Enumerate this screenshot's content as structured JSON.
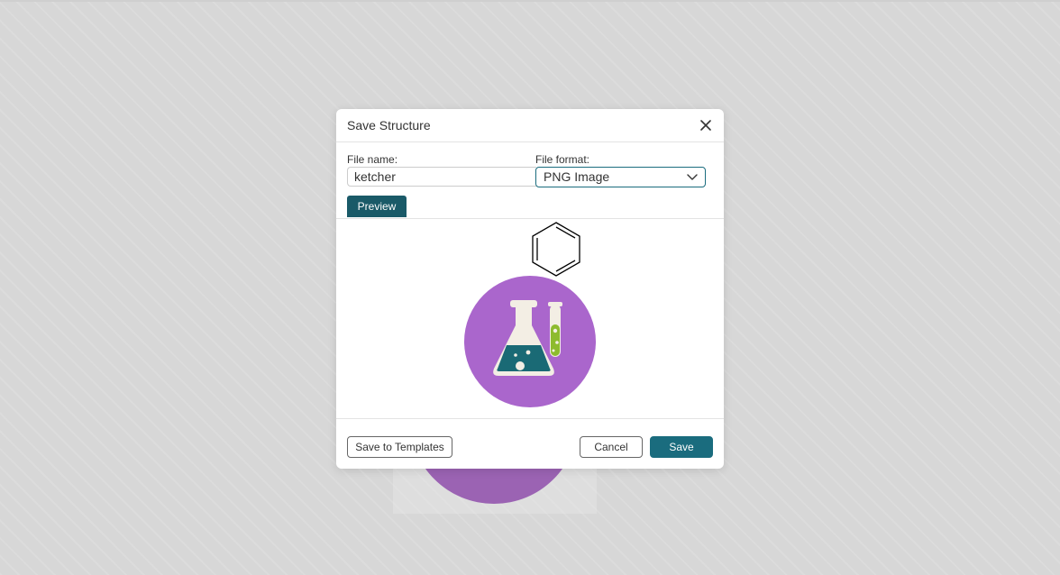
{
  "dialog": {
    "title": "Save Structure",
    "close_icon": "close-icon"
  },
  "form": {
    "file_name_label": "File name:",
    "file_name_value": "ketcher",
    "file_format_label": "File format:",
    "file_format_value": "PNG Image",
    "dropdown_icon": "chevron-down-icon"
  },
  "tabs": [
    {
      "label": "Preview",
      "active": true
    }
  ],
  "preview": {
    "structure_icon": "benzene-ring-icon",
    "logo_icon": "chemistry-flask-logo-icon"
  },
  "footer": {
    "save_to_templates_label": "Save to Templates",
    "cancel_label": "Cancel",
    "save_label": "Save"
  },
  "colors": {
    "accent": "#1a6c7e",
    "tab_active": "#1a5a68",
    "logo_purple": "#aa66cc",
    "flask_teal": "#1a6a75",
    "tube_green": "#8dbb2e"
  }
}
